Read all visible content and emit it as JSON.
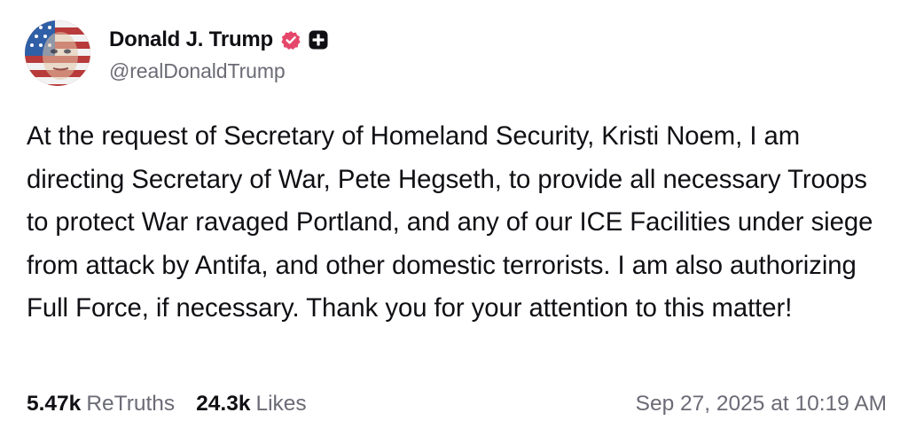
{
  "post": {
    "author": {
      "display_name": "Donald J. Trump",
      "handle": "@realDonaldTrump",
      "verified_icon": "verified-badge-icon",
      "plus_icon": "plus-badge-icon",
      "verified_color": "#e5476b"
    },
    "text": "At the request of Secretary of Homeland Security, Kristi Noem, I am directing Secretary of War, Pete Hegseth, to provide all necessary Troops to protect War ravaged Portland, and any of our ICE Facilities under siege from attack by Antifa, and other domestic terrorists. I am also authorizing Full Force, if necessary. Thank you for your attention to this matter!",
    "stats": {
      "retruths_count": "5.47k",
      "retruths_label": "ReTruths",
      "likes_count": "24.3k",
      "likes_label": "Likes"
    },
    "timestamp": "Sep 27, 2025 at 10:19 AM"
  }
}
